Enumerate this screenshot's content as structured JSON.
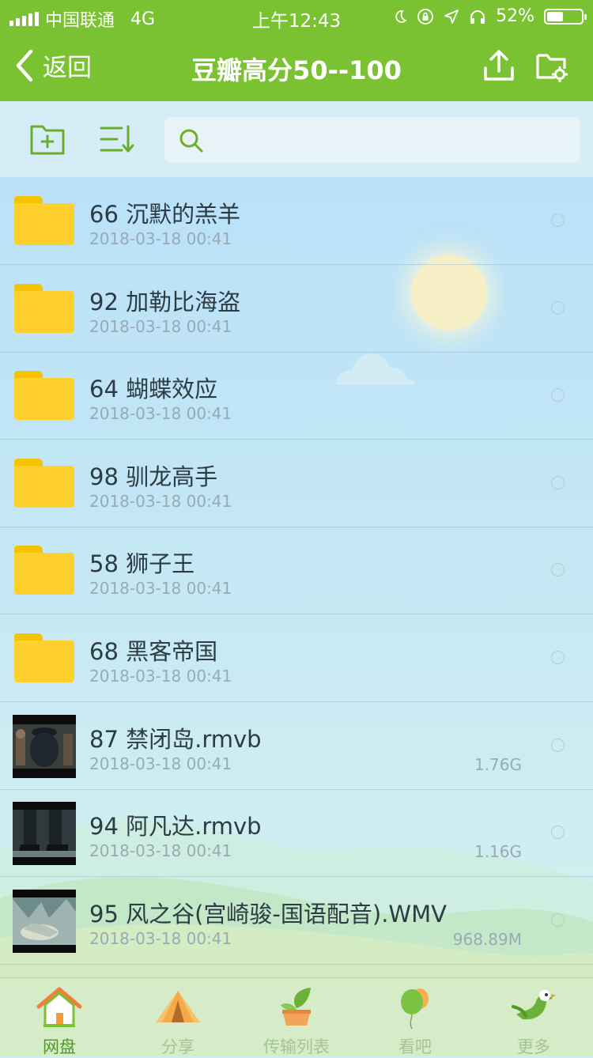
{
  "status_bar": {
    "carrier": "中国联通",
    "network": "4G",
    "time": "上午12:43",
    "battery": "52%",
    "battery_level": 0.52
  },
  "nav": {
    "back_label": "返回",
    "title": "豆瓣高分50--100"
  },
  "search": {
    "placeholder": ""
  },
  "files": [
    {
      "name": "66 沉默的羔羊",
      "date": "2018-03-18 00:41",
      "size": "",
      "type": "folder"
    },
    {
      "name": "92 加勒比海盗",
      "date": "2018-03-18 00:41",
      "size": "",
      "type": "folder"
    },
    {
      "name": "64 蝴蝶效应",
      "date": "2018-03-18 00:41",
      "size": "",
      "type": "folder"
    },
    {
      "name": "98 驯龙高手",
      "date": "2018-03-18 00:41",
      "size": "",
      "type": "folder"
    },
    {
      "name": "58 狮子王",
      "date": "2018-03-18 00:41",
      "size": "",
      "type": "folder"
    },
    {
      "name": "68 黑客帝国",
      "date": "2018-03-18 00:41",
      "size": "",
      "type": "folder"
    },
    {
      "name": "87 禁闭岛.rmvb",
      "date": "2018-03-18 00:41",
      "size": "1.76G",
      "type": "video"
    },
    {
      "name": "94 阿凡达.rmvb",
      "date": "2018-03-18 00:41",
      "size": "1.16G",
      "type": "video"
    },
    {
      "name": "95 风之谷(宫崎骏-国语配音).WMV",
      "date": "2018-03-18 00:41",
      "size": "968.89M",
      "type": "video"
    }
  ],
  "tabs": [
    {
      "label": "网盘",
      "icon": "house-icon",
      "active": true
    },
    {
      "label": "分享",
      "icon": "tent-icon",
      "active": false
    },
    {
      "label": "传输列表",
      "icon": "plant-pot-icon",
      "active": false
    },
    {
      "label": "看吧",
      "icon": "balloon-icon",
      "active": false
    },
    {
      "label": "更多",
      "icon": "bird-icon",
      "active": false
    }
  ],
  "colors": {
    "accent": "#7ac232",
    "folder": "#ffd02d",
    "active_tab": "#4e9a25",
    "inactive_tab": "#a6c392"
  }
}
